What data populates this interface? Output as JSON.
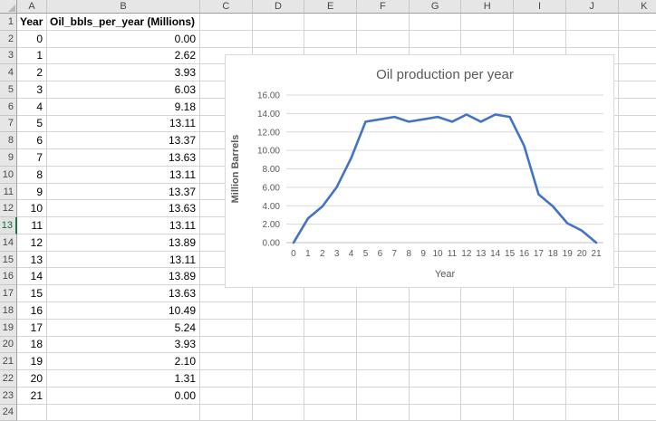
{
  "spreadsheet": {
    "column_headers": [
      "A",
      "B",
      "C",
      "D",
      "E",
      "F",
      "G",
      "H",
      "I",
      "J",
      "K"
    ],
    "row_numbers": [
      1,
      2,
      3,
      4,
      5,
      6,
      7,
      8,
      9,
      10,
      11,
      12,
      13,
      14,
      15,
      16,
      17,
      18,
      19,
      20,
      21,
      22,
      23,
      24
    ],
    "active_row": 13,
    "header_labels": {
      "year": "Year",
      "value": "Oil_bbls_per_year (Millions)"
    },
    "data": [
      {
        "year": "0",
        "value": "0.00"
      },
      {
        "year": "1",
        "value": "2.62"
      },
      {
        "year": "2",
        "value": "3.93"
      },
      {
        "year": "3",
        "value": "6.03"
      },
      {
        "year": "4",
        "value": "9.18"
      },
      {
        "year": "5",
        "value": "13.11"
      },
      {
        "year": "6",
        "value": "13.37"
      },
      {
        "year": "7",
        "value": "13.63"
      },
      {
        "year": "8",
        "value": "13.11"
      },
      {
        "year": "9",
        "value": "13.37"
      },
      {
        "year": "10",
        "value": "13.63"
      },
      {
        "year": "11",
        "value": "13.11"
      },
      {
        "year": "12",
        "value": "13.89"
      },
      {
        "year": "13",
        "value": "13.11"
      },
      {
        "year": "14",
        "value": "13.89"
      },
      {
        "year": "15",
        "value": "13.63"
      },
      {
        "year": "16",
        "value": "10.49"
      },
      {
        "year": "17",
        "value": "5.24"
      },
      {
        "year": "18",
        "value": "3.93"
      },
      {
        "year": "19",
        "value": "2.10"
      },
      {
        "year": "20",
        "value": "1.31"
      },
      {
        "year": "21",
        "value": "0.00"
      }
    ],
    "colors": {
      "accent_green": "#217346",
      "header_bg": "#e6e6e6",
      "gridline": "#d4d4d4"
    }
  },
  "chart_data": {
    "type": "line",
    "title": "Oil production per year",
    "xlabel": "Year",
    "ylabel": "Million Barrels",
    "x": [
      0,
      1,
      2,
      3,
      4,
      5,
      6,
      7,
      8,
      9,
      10,
      11,
      12,
      13,
      14,
      15,
      16,
      17,
      18,
      19,
      20,
      21
    ],
    "series": [
      {
        "name": "Oil_bbls_per_year (Millions)",
        "values": [
          0.0,
          2.62,
          3.93,
          6.03,
          9.18,
          13.11,
          13.37,
          13.63,
          13.11,
          13.37,
          13.63,
          13.11,
          13.89,
          13.11,
          13.89,
          13.63,
          10.49,
          5.24,
          3.93,
          2.1,
          1.31,
          0.0
        ]
      }
    ],
    "ylim": [
      0,
      16
    ],
    "ytick_step": 2,
    "ytick_labels": [
      "0.00",
      "2.00",
      "4.00",
      "6.00",
      "8.00",
      "10.00",
      "12.00",
      "14.00",
      "16.00"
    ],
    "xtick_labels": [
      "0",
      "1",
      "2",
      "3",
      "4",
      "5",
      "6",
      "7",
      "8",
      "9",
      "10",
      "11",
      "12",
      "13",
      "14",
      "15",
      "16",
      "17",
      "18",
      "19",
      "20",
      "21"
    ],
    "grid": true,
    "legend": "none",
    "line_color": "#4472c4",
    "text_color": "#595959",
    "gridline_color": "#d9d9d9",
    "axis_color": "#bfbfbf"
  }
}
